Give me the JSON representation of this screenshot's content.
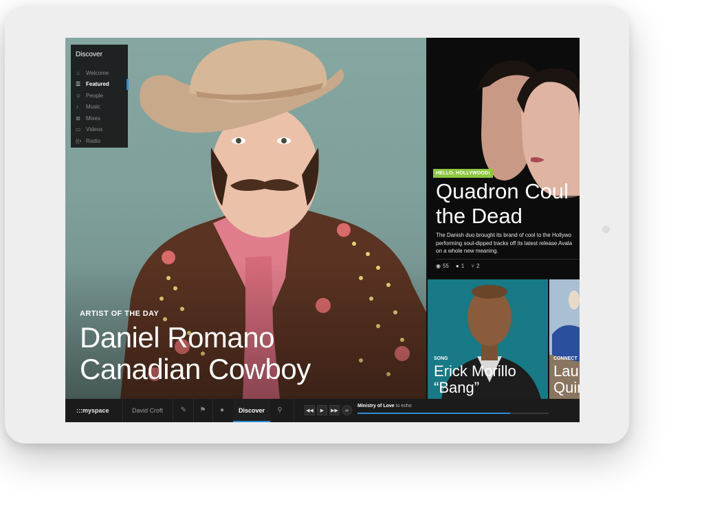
{
  "discover_menu": {
    "title": "Discover",
    "items": [
      {
        "label": "Welcome",
        "icon": "flame-icon",
        "active": false
      },
      {
        "label": "Featured",
        "icon": "list-icon",
        "active": true
      },
      {
        "label": "People",
        "icon": "people-icon",
        "active": false
      },
      {
        "label": "Music",
        "icon": "note-icon",
        "active": false
      },
      {
        "label": "Mixes",
        "icon": "mix-icon",
        "active": false
      },
      {
        "label": "Videos",
        "icon": "video-icon",
        "active": false
      },
      {
        "label": "Radio",
        "icon": "radio-icon",
        "active": false
      }
    ]
  },
  "hero": {
    "kicker": "ARTIST OF THE DAY",
    "title_line1": "Daniel Romano",
    "title_line2": "Canadian Cowboy"
  },
  "feature_card": {
    "tag": "HELLO, HOLLYWOOD!",
    "title_line1": "Quadron Coul",
    "title_line2": "the Dead",
    "desc_line1": "The Danish duo brought its brand of cool to the Hollywo",
    "desc_line2": "performing soul-dipped tracks off its latest release Avala",
    "desc_line3": "on a whole new meaning.",
    "views": "55",
    "comments": "1",
    "shares": "2"
  },
  "song_card": {
    "kicker": "SONG",
    "title_line1": "Erick Morillo",
    "title_line2": "“Bang”"
  },
  "connect_card": {
    "kicker": "CONNECT",
    "title_line1": "Lau",
    "title_line2": "Quir"
  },
  "bottom_bar": {
    "logo": ":::myspace",
    "user": "David Croft",
    "discover": "Discover",
    "now_playing_track": "Ministry of Love",
    "now_playing_artist": "Io echo",
    "progress": 0.8
  },
  "colors": {
    "accent": "#2d8fd6",
    "tag_green": "#8dc63f"
  }
}
